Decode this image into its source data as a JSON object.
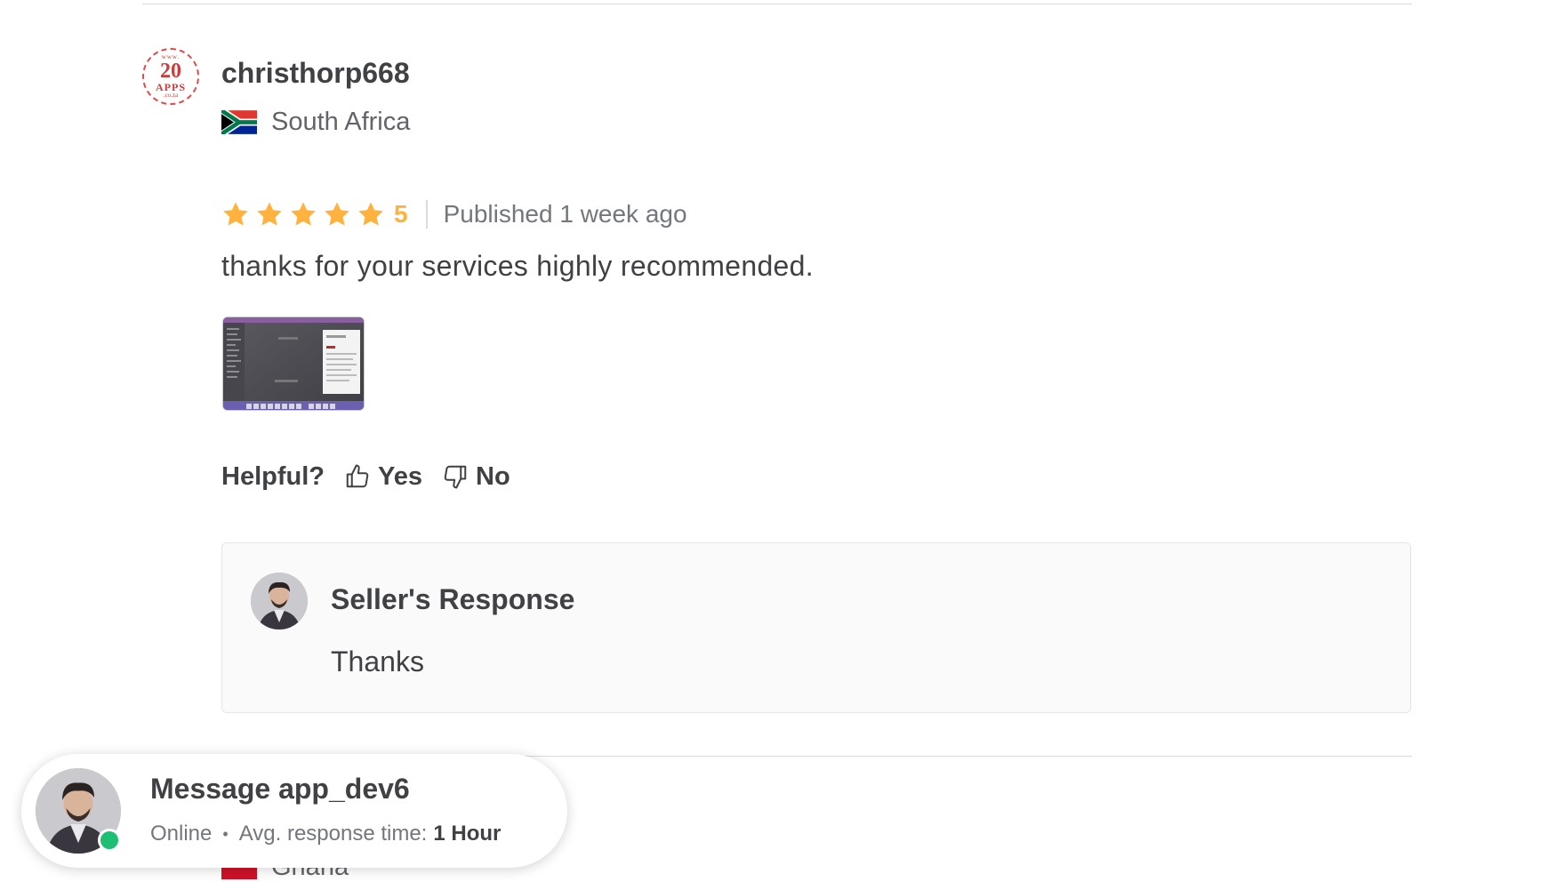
{
  "review": {
    "logo": {
      "line1": "www.",
      "line2": "20",
      "line3": "APPS",
      "line4": ".co.za"
    },
    "username": "christhorp668",
    "country": "South Africa",
    "stars": 5,
    "rating_value": "5",
    "published": "Published 1 week ago",
    "text": "thanks for your services highly recommended.",
    "helpful": {
      "label": "Helpful?",
      "yes": "Yes",
      "no": "No"
    },
    "seller_response": {
      "title": "Seller's Response",
      "text": "Thanks"
    }
  },
  "next_review": {
    "country": "Ghana"
  },
  "chat": {
    "title": "Message app_dev6",
    "status": "Online",
    "separator": "•",
    "response_label": "Avg. response time:",
    "response_time": "1 Hour"
  },
  "colors": {
    "star": "#ffb33e",
    "online": "#1dbf73",
    "text": "#404145",
    "muted": "#74767e"
  },
  "icons": [
    "star-icon",
    "thumbs-up-icon",
    "thumbs-down-icon",
    "south-africa-flag-icon"
  ]
}
